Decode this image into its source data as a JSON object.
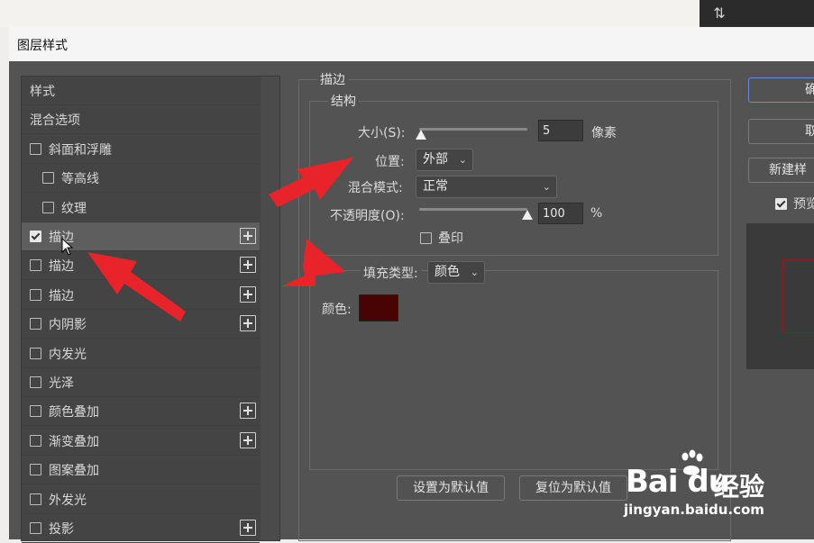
{
  "dialog": {
    "title": "图层样式"
  },
  "left_list": {
    "items": [
      {
        "label": "样式",
        "checkbox": false,
        "checked": false,
        "plus": false,
        "indent": 0,
        "selected": false
      },
      {
        "label": "混合选项",
        "checkbox": false,
        "checked": false,
        "plus": false,
        "indent": 0,
        "selected": false
      },
      {
        "label": "斜面和浮雕",
        "checkbox": true,
        "checked": false,
        "plus": false,
        "indent": 0,
        "selected": false
      },
      {
        "label": "等高线",
        "checkbox": true,
        "checked": false,
        "plus": false,
        "indent": 1,
        "selected": false
      },
      {
        "label": "纹理",
        "checkbox": true,
        "checked": false,
        "plus": false,
        "indent": 1,
        "selected": false
      },
      {
        "label": "描边",
        "checkbox": true,
        "checked": true,
        "plus": true,
        "indent": 0,
        "selected": true
      },
      {
        "label": "描边",
        "checkbox": true,
        "checked": false,
        "plus": true,
        "indent": 0,
        "selected": false
      },
      {
        "label": "描边",
        "checkbox": true,
        "checked": false,
        "plus": true,
        "indent": 0,
        "selected": false
      },
      {
        "label": "内阴影",
        "checkbox": true,
        "checked": false,
        "plus": true,
        "indent": 0,
        "selected": false
      },
      {
        "label": "内发光",
        "checkbox": true,
        "checked": false,
        "plus": false,
        "indent": 0,
        "selected": false
      },
      {
        "label": "光泽",
        "checkbox": true,
        "checked": false,
        "plus": false,
        "indent": 0,
        "selected": false
      },
      {
        "label": "颜色叠加",
        "checkbox": true,
        "checked": false,
        "plus": true,
        "indent": 0,
        "selected": false
      },
      {
        "label": "渐变叠加",
        "checkbox": true,
        "checked": false,
        "plus": true,
        "indent": 0,
        "selected": false
      },
      {
        "label": "图案叠加",
        "checkbox": true,
        "checked": false,
        "plus": false,
        "indent": 0,
        "selected": false
      },
      {
        "label": "外发光",
        "checkbox": true,
        "checked": false,
        "plus": false,
        "indent": 0,
        "selected": false
      },
      {
        "label": "投影",
        "checkbox": true,
        "checked": false,
        "plus": true,
        "indent": 0,
        "selected": false
      }
    ]
  },
  "stroke": {
    "title": "描边",
    "structure": {
      "title": "结构",
      "size_label": "大小(S):",
      "size_value": "5",
      "size_unit": "像素",
      "size_level": 0.02,
      "position_label": "位置:",
      "position_value": "外部",
      "blend_label": "混合模式:",
      "blend_value": "正常",
      "opacity_label": "不透明度(O):",
      "opacity_value": "100",
      "opacity_unit": "%",
      "opacity_level": 1.0,
      "overprint_label": "叠印"
    },
    "fill": {
      "type_label": "填充类型:",
      "type_value": "颜色",
      "color_label": "颜色:",
      "color_hex": "#4a0303"
    },
    "set_default": "设置为默认值",
    "reset_default": "复位为默认值"
  },
  "right": {
    "ok": "确",
    "cancel": "取",
    "new_style": "新建样",
    "preview": "预览",
    "preview_checked": true
  },
  "watermark": {
    "brand": "Bai du",
    "cn": "经验",
    "url": "jingyan.baidu.com"
  },
  "colors": {
    "accent_arrow": "#e8232a",
    "dialog_bg": "#535353"
  }
}
